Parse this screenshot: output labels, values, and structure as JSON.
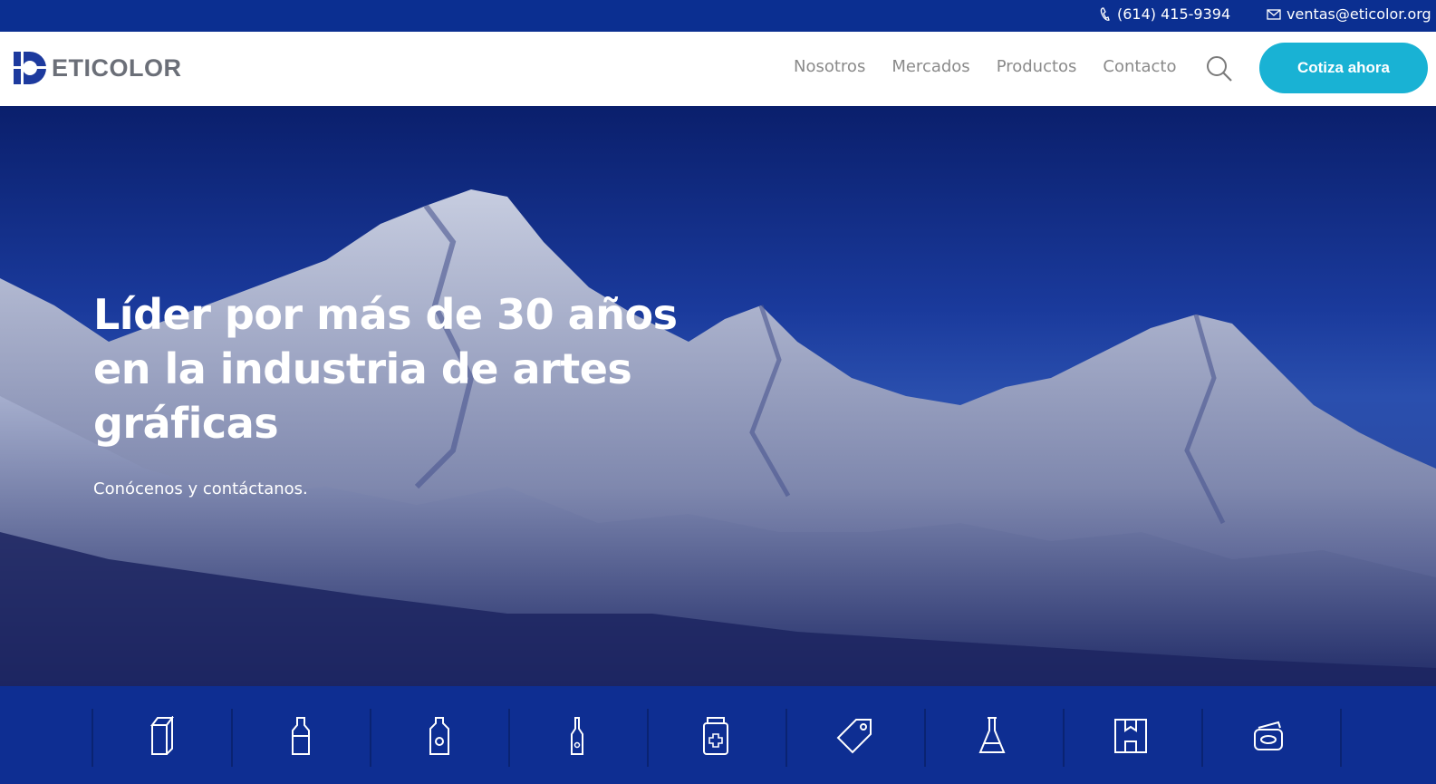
{
  "topbar": {
    "phone": "(614) 415-9394",
    "email": "ventas@eticolor.org",
    "phone_icon": "phone-icon",
    "email_icon": "envelope-icon"
  },
  "header": {
    "logo_text": "ETICOLOR",
    "nav": [
      "Nosotros",
      "Mercados",
      "Productos",
      "Contacto"
    ],
    "search_icon": "search-icon",
    "cta_label": "Cotiza ahora"
  },
  "hero": {
    "title": "Líder por más de 30 años en la industria de artes gráficas",
    "subtitle": "Conócenos y contáctanos."
  },
  "market_icons": [
    "milk-carton-icon",
    "bottle-icon",
    "detergent-bottle-icon",
    "beer-bottle-icon",
    "medicine-jar-icon",
    "tag-icon",
    "flask-icon",
    "box-icon",
    "cosmetic-jar-icon"
  ],
  "colors": {
    "topbar": "#0b2f91",
    "cta": "#19b2d4",
    "strip": "#0e2e92",
    "logo_blue": "#1d3a9e"
  }
}
